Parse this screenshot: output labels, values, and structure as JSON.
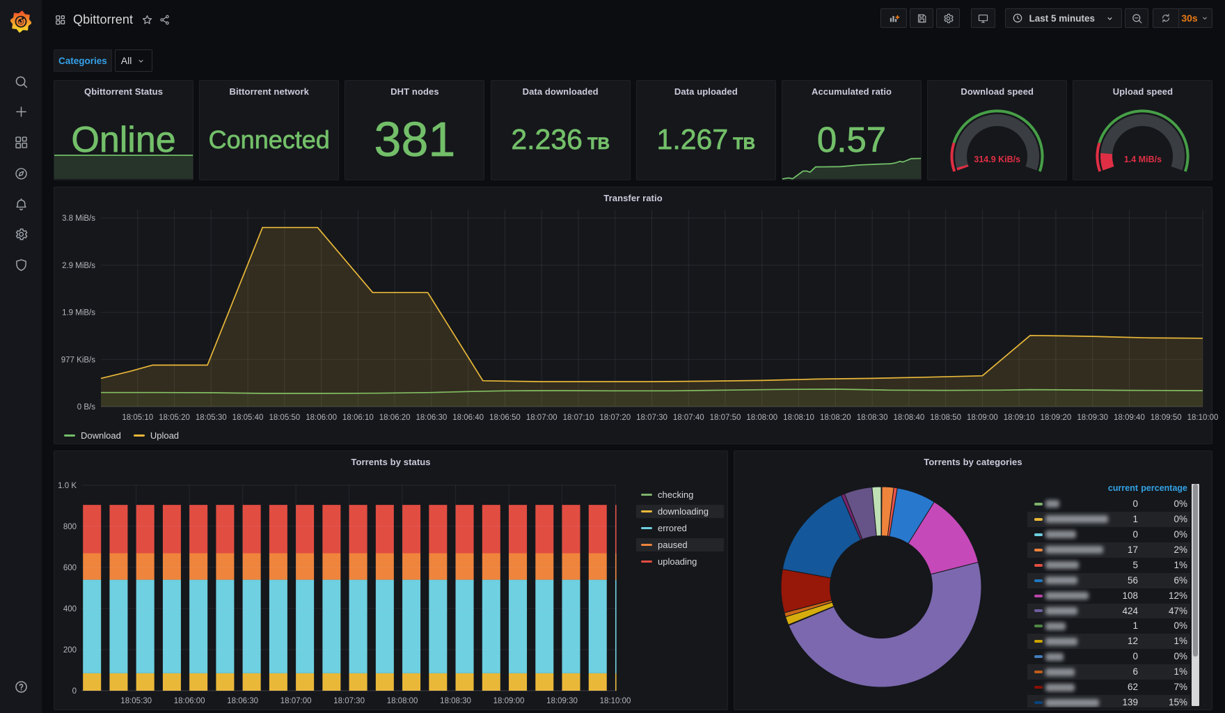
{
  "header": {
    "title": "Qbittorrent",
    "toolbar": {
      "time_range": "Last 5 minutes",
      "refresh_interval": "30s",
      "buttons": [
        "add-panel",
        "save-dashboard",
        "dashboard-settings",
        "cycle-view-mode",
        "time-picker",
        "zoom-out-time-range",
        "refresh-dashboard",
        "refresh-interval-picker"
      ]
    }
  },
  "sidebar": {
    "items": [
      {
        "icon": "grafana-logo"
      },
      {
        "icon": "search"
      },
      {
        "icon": "plus"
      },
      {
        "icon": "dashboards"
      },
      {
        "icon": "explore"
      },
      {
        "icon": "alerting"
      },
      {
        "icon": "configuration"
      },
      {
        "icon": "server-admin"
      },
      {
        "icon": "help"
      }
    ]
  },
  "submenu": {
    "label": "Categories",
    "value": "All"
  },
  "colors": {
    "green": "#73bf69",
    "yellow": "#eab839",
    "cyan": "#6ed0e0",
    "orange": "#ef843c",
    "red": "#e24d42",
    "gauge_red": "#e02f44",
    "gauge_text_red": "#f2495c",
    "gauge_green": "#479f47",
    "link_blue": "#35a1e8",
    "table_head_blue": "#33a2e5",
    "refresh_orange": "#eb7b18",
    "panel_bg": "#15171b",
    "canvas_bg": "#0c0d10"
  },
  "stat_panels": [
    {
      "title": "Qbittorrent Status",
      "type": "stat-spark",
      "value": "Online",
      "font": 52,
      "spark": {
        "amp": 34,
        "points": [
          [
            0,
            1
          ],
          [
            1,
            1
          ]
        ]
      }
    },
    {
      "title": "Bittorrent network",
      "type": "stat",
      "value": "Connected",
      "font": 36
    },
    {
      "title": "DHT nodes",
      "type": "stat",
      "value": "381",
      "font": 70
    },
    {
      "title": "Data downloaded",
      "type": "stat",
      "value": "2.236",
      "unit": "TB",
      "font": 41,
      "unit_font": 24
    },
    {
      "title": "Data uploaded",
      "type": "stat",
      "value": "1.267",
      "unit": "TB",
      "font": 41,
      "unit_font": 24
    },
    {
      "title": "Accumulated ratio",
      "type": "stat-spark",
      "value": "0.57",
      "font": 51,
      "spark": {
        "amp": 29.5,
        "points": [
          [
            0,
            0.0
          ],
          [
            0.045,
            0.05
          ],
          [
            0.075,
            0.01
          ],
          [
            0.15,
            0.385
          ],
          [
            0.175,
            0.385
          ],
          [
            0.2,
            0.33
          ],
          [
            0.24,
            0.586
          ],
          [
            0.3,
            0.59
          ],
          [
            0.42,
            0.6
          ],
          [
            0.55,
            0.678
          ],
          [
            0.7,
            0.722
          ],
          [
            0.78,
            0.74
          ],
          [
            0.82,
            0.79
          ],
          [
            0.85,
            0.857
          ],
          [
            0.87,
            0.824
          ],
          [
            0.93,
            0.99
          ],
          [
            1,
            1
          ]
        ]
      }
    },
    {
      "title": "Download speed",
      "type": "gauge",
      "value": "314.9 KiB/s",
      "fraction": 0.016,
      "threshold_fraction": 0.168
    },
    {
      "title": "Upload speed",
      "type": "gauge",
      "value": "1.4 MiB/s",
      "fraction": 0.109,
      "threshold_fraction": 0.168
    }
  ],
  "chart_data": [
    {
      "type": "line",
      "title": "Transfer ratio",
      "x_range_seconds": [
        0,
        300
      ],
      "x_tick_step": 10,
      "x_tick_labels": [
        "18:05:10",
        "18:05:20",
        "18:05:30",
        "18:05:40",
        "18:05:50",
        "18:06:00",
        "18:06:10",
        "18:06:20",
        "18:06:30",
        "18:06:40",
        "18:06:50",
        "18:07:00",
        "18:07:10",
        "18:07:20",
        "18:07:30",
        "18:07:40",
        "18:07:50",
        "18:08:00",
        "18:08:10",
        "18:08:20",
        "18:08:30",
        "18:08:40",
        "18:08:50",
        "18:09:00",
        "18:09:10",
        "18:09:20",
        "18:09:30",
        "18:09:40",
        "18:09:50",
        "18:10:00"
      ],
      "y_ticks": [
        {
          "v": 0,
          "label": "0 B/s"
        },
        {
          "v": 1,
          "label": "977 KiB/s"
        },
        {
          "v": 2,
          "label": "1.9 MiB/s"
        },
        {
          "v": 3,
          "label": "2.9 MiB/s"
        },
        {
          "v": 4,
          "label": "3.8 MiB/s"
        }
      ],
      "y_max": 4.18,
      "grid": true,
      "legend_position": "bottom",
      "series": [
        {
          "name": "Download",
          "color": "#73bf69",
          "fill_opacity": 0.08,
          "points": [
            [
              0,
              0.3
            ],
            [
              15,
              0.3
            ],
            [
              30,
              0.295
            ],
            [
              45,
              0.28
            ],
            [
              60,
              0.28
            ],
            [
              75,
              0.285
            ],
            [
              90,
              0.3
            ],
            [
              100,
              0.32
            ],
            [
              110,
              0.335
            ],
            [
              125,
              0.34
            ],
            [
              140,
              0.335
            ],
            [
              155,
              0.335
            ],
            [
              170,
              0.35
            ],
            [
              185,
              0.365
            ],
            [
              200,
              0.37
            ],
            [
              215,
              0.35
            ],
            [
              230,
              0.345
            ],
            [
              245,
              0.35
            ],
            [
              253,
              0.36
            ],
            [
              265,
              0.355
            ],
            [
              280,
              0.345
            ],
            [
              300,
              0.34
            ]
          ]
        },
        {
          "name": "Upload",
          "color": "#eab839",
          "fill_opacity": 0.14,
          "points": [
            [
              0,
              0.6
            ],
            [
              8,
              0.75
            ],
            [
              14,
              0.88
            ],
            [
              29,
              0.88
            ],
            [
              44,
              3.8
            ],
            [
              59,
              3.8
            ],
            [
              74,
              2.42
            ],
            [
              89,
              2.42
            ],
            [
              104,
              0.55
            ],
            [
              120,
              0.53
            ],
            [
              135,
              0.53
            ],
            [
              150,
              0.53
            ],
            [
              165,
              0.54
            ],
            [
              180,
              0.555
            ],
            [
              195,
              0.585
            ],
            [
              210,
              0.6
            ],
            [
              225,
              0.625
            ],
            [
              240,
              0.655
            ],
            [
              253,
              1.51
            ],
            [
              262,
              1.5
            ],
            [
              270,
              1.49
            ],
            [
              277,
              1.475
            ],
            [
              285,
              1.46
            ],
            [
              292,
              1.455
            ],
            [
              300,
              1.45
            ]
          ]
        }
      ]
    },
    {
      "type": "bar",
      "title": "Torrents by status",
      "stacked": true,
      "bar_count": 21,
      "x_tick_labels": [
        "18:05:30",
        "18:06:00",
        "18:06:30",
        "18:07:00",
        "18:07:30",
        "18:08:00",
        "18:08:30",
        "18:09:00",
        "18:09:30",
        "18:10:00"
      ],
      "y_ticks": [
        {
          "v": 0,
          "label": "0"
        },
        {
          "v": 200,
          "label": "200"
        },
        {
          "v": 400,
          "label": "400"
        },
        {
          "v": 600,
          "label": "600"
        },
        {
          "v": 800,
          "label": "800"
        },
        {
          "v": 1000,
          "label": "1.0 K"
        }
      ],
      "y_max": 1001,
      "series": [
        {
          "name": "checking",
          "color": "#7eb26d",
          "value": 0,
          "highlight": false
        },
        {
          "name": "downloading",
          "color": "#eab839",
          "value": 85,
          "highlight": true
        },
        {
          "name": "errored",
          "color": "#6ed0e0",
          "value": 455,
          "highlight": false
        },
        {
          "name": "paused",
          "color": "#ef843c",
          "value": 129,
          "highlight": true
        },
        {
          "name": "uploading",
          "color": "#e24d42",
          "value": 235,
          "highlight": false
        }
      ],
      "legend_position": "right"
    },
    {
      "type": "pie",
      "title": "Torrents by categories",
      "donut": true,
      "slices": [
        {
          "value": 1,
          "color": "#eab839"
        },
        {
          "value": 17,
          "color": "#ef843c"
        },
        {
          "value": 5,
          "color": "#e8534a"
        },
        {
          "value": 56,
          "color": "#2878ce"
        },
        {
          "value": 108,
          "color": "#c549b8"
        },
        {
          "value": 424,
          "color": "#7b68ae"
        },
        {
          "value": 1,
          "color": "#508642"
        },
        {
          "value": 12,
          "color": "#d6ad0d"
        },
        {
          "value": 6,
          "color": "#cc6817"
        },
        {
          "value": 62,
          "color": "#971708"
        },
        {
          "value": 139,
          "color": "#14579a"
        },
        {
          "value": 5,
          "color": "#7a2570"
        },
        {
          "value": 40,
          "color": "#665387"
        },
        {
          "value": 13,
          "color": "#bfe0b4"
        }
      ],
      "table": {
        "headers": [
          "current",
          "percentage"
        ],
        "rows": [
          {
            "dash": "#7eb26d",
            "label_w": 20,
            "current": "0",
            "percentage": "0%"
          },
          {
            "dash": "#eab839",
            "label_w": 90,
            "current": "1",
            "percentage": "0%"
          },
          {
            "dash": "#6ed0e0",
            "label_w": 44,
            "current": "0",
            "percentage": "0%"
          },
          {
            "dash": "#ef843c",
            "label_w": 83,
            "current": "17",
            "percentage": "2%"
          },
          {
            "dash": "#e24d42",
            "label_w": 48,
            "current": "5",
            "percentage": "1%"
          },
          {
            "dash": "#1f78c1",
            "label_w": 46,
            "current": "56",
            "percentage": "6%"
          },
          {
            "dash": "#ba43a9",
            "label_w": 62,
            "current": "108",
            "percentage": "12%"
          },
          {
            "dash": "#705da0",
            "label_w": 46,
            "current": "424",
            "percentage": "47%"
          },
          {
            "dash": "#508642",
            "label_w": 29,
            "current": "1",
            "percentage": "0%"
          },
          {
            "dash": "#cca300",
            "label_w": 46,
            "current": "12",
            "percentage": "1%"
          },
          {
            "dash": "#447ebc",
            "label_w": 26,
            "current": "0",
            "percentage": "0%"
          },
          {
            "dash": "#c15c17",
            "label_w": 42,
            "current": "6",
            "percentage": "1%"
          },
          {
            "dash": "#890f02",
            "label_w": 42,
            "current": "62",
            "percentage": "7%"
          },
          {
            "dash": "#0a437c",
            "label_w": 77,
            "current": "139",
            "percentage": "15%"
          }
        ]
      }
    }
  ]
}
